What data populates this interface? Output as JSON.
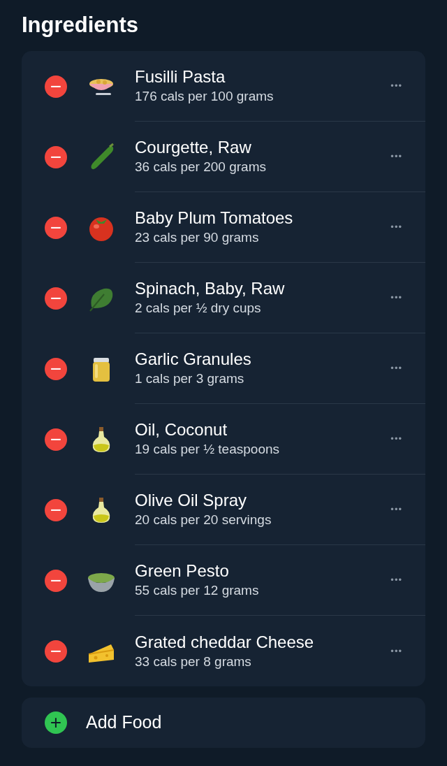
{
  "title": "Ingredients",
  "ingredients": [
    {
      "kind": "pasta",
      "name": "Fusilli Pasta",
      "detail": "176 cals per 100 grams",
      "remove_icon": "−",
      "more_icon": "•••"
    },
    {
      "kind": "courgette",
      "name": "Courgette, Raw",
      "detail": "36 cals per 200 grams",
      "remove_icon": "−",
      "more_icon": "•••"
    },
    {
      "kind": "tomato",
      "name": "Baby Plum Tomatoes",
      "detail": "23 cals per 90 grams",
      "remove_icon": "−",
      "more_icon": "•••"
    },
    {
      "kind": "spinach",
      "name": "Spinach, Baby, Raw",
      "detail": "2 cals per ½ dry cups",
      "remove_icon": "−",
      "more_icon": "•••"
    },
    {
      "kind": "jar",
      "name": "Garlic Granules",
      "detail": "1 cals per 3 grams",
      "remove_icon": "−",
      "more_icon": "•••"
    },
    {
      "kind": "oil",
      "name": "Oil, Coconut",
      "detail": "19 cals per ½ teaspoons",
      "remove_icon": "−",
      "more_icon": "•••"
    },
    {
      "kind": "oil",
      "name": "Olive Oil Spray",
      "detail": "20 cals per 20 servings",
      "remove_icon": "−",
      "more_icon": "•••"
    },
    {
      "kind": "bowl",
      "name": "Green Pesto",
      "detail": "55 cals per 12 grams",
      "remove_icon": "−",
      "more_icon": "•••"
    },
    {
      "kind": "cheese",
      "name": "Grated cheddar Cheese",
      "detail": "33 cals per 8 grams",
      "remove_icon": "−",
      "more_icon": "•••"
    }
  ],
  "add_food": {
    "icon": "+",
    "label": "Add Food"
  }
}
